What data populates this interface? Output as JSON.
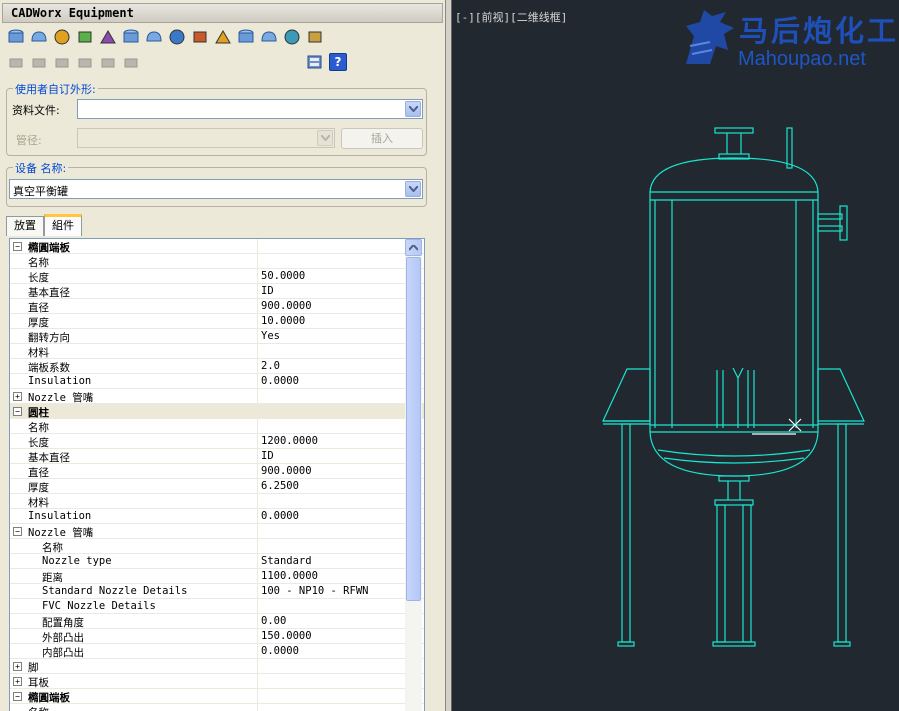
{
  "window": {
    "title": "CADWorx Equipment"
  },
  "toolbar": {
    "row1_icons": [
      "head-icon",
      "dish-icon",
      "flange-icon",
      "cone-icon",
      "elbow-icon",
      "sphere-icon",
      "box-icon",
      "nozzle-icon",
      "cube-icon",
      "coil-icon",
      "support-icon",
      "saddle-icon",
      "boot-icon",
      "tray-icon"
    ],
    "row2_icons": [
      "pipe-stub-icon",
      "bar-icon",
      "square-icon",
      "hexagon-icon",
      "octagon-icon",
      "shield-icon"
    ],
    "properties_icon": "properties-icon",
    "help_icon": "help-icon",
    "help_glyph": "?"
  },
  "custom_shape": {
    "legend": "使用者自订外形:",
    "datafile_label": "资料文件:",
    "datafile_value": "",
    "pipe_label": "管径:",
    "pipe_value": "",
    "insert_label": "插入"
  },
  "equipment": {
    "legend": "设备 名称:",
    "name_value": "真空平衡罐"
  },
  "tabs": [
    {
      "label": "放置",
      "active": false
    },
    {
      "label": "組件",
      "active": true
    }
  ],
  "grid": {
    "rows": [
      {
        "level": 0,
        "toggle": "−",
        "name": "橢圓端板",
        "value": "",
        "bold": true
      },
      {
        "level": 1,
        "toggle": "",
        "name": "名称",
        "value": ""
      },
      {
        "level": 1,
        "toggle": "",
        "name": "长度",
        "value": "50.0000"
      },
      {
        "level": 1,
        "toggle": "",
        "name": "基本直径",
        "value": "ID"
      },
      {
        "level": 1,
        "toggle": "",
        "name": "直径",
        "value": "900.0000"
      },
      {
        "level": 1,
        "toggle": "",
        "name": "厚度",
        "value": "10.0000"
      },
      {
        "level": 1,
        "toggle": "",
        "name": "翻转方向",
        "value": "Yes"
      },
      {
        "level": 1,
        "toggle": "",
        "name": "材料",
        "value": ""
      },
      {
        "level": 1,
        "toggle": "",
        "name": "端板系数",
        "value": "2.0"
      },
      {
        "level": 1,
        "toggle": "",
        "name": "Insulation",
        "value": "0.0000"
      },
      {
        "level": 0,
        "toggle": "+",
        "name": "Nozzle  管嘴",
        "value": ""
      },
      {
        "level": 0,
        "toggle": "−",
        "name": "圆柱",
        "value": "",
        "bold": true,
        "selected": true
      },
      {
        "level": 1,
        "toggle": "",
        "name": "名称",
        "value": ""
      },
      {
        "level": 1,
        "toggle": "",
        "name": "长度",
        "value": "1200.0000"
      },
      {
        "level": 1,
        "toggle": "",
        "name": "基本直径",
        "value": "ID"
      },
      {
        "level": 1,
        "toggle": "",
        "name": "直径",
        "value": "900.0000"
      },
      {
        "level": 1,
        "toggle": "",
        "name": "厚度",
        "value": "6.2500"
      },
      {
        "level": 1,
        "toggle": "",
        "name": "材料",
        "value": ""
      },
      {
        "level": 1,
        "toggle": "",
        "name": "Insulation",
        "value": "0.0000"
      },
      {
        "level": 0,
        "toggle": "−",
        "name": "Nozzle  管嘴",
        "value": ""
      },
      {
        "level": 2,
        "toggle": "",
        "name": "名称",
        "value": ""
      },
      {
        "level": 2,
        "toggle": "",
        "name": "Nozzle type",
        "value": "Standard"
      },
      {
        "level": 2,
        "toggle": "",
        "name": "距离",
        "value": "1100.0000"
      },
      {
        "level": 2,
        "toggle": "",
        "name": "Standard Nozzle Details",
        "value": "100 - NP10 - RFWN"
      },
      {
        "level": 2,
        "toggle": "",
        "name": "FVC Nozzle Details",
        "value": ""
      },
      {
        "level": 2,
        "toggle": "",
        "name": "配置角度",
        "value": "0.00"
      },
      {
        "level": 2,
        "toggle": "",
        "name": "外部凸出",
        "value": "150.0000"
      },
      {
        "level": 2,
        "toggle": "",
        "name": "内部凸出",
        "value": "0.0000"
      },
      {
        "level": 0,
        "toggle": "+",
        "name": "脚",
        "value": ""
      },
      {
        "level": 0,
        "toggle": "+",
        "name": "耳板",
        "value": ""
      },
      {
        "level": 0,
        "toggle": "−",
        "name": "橢圓端板",
        "value": "",
        "bold": true
      },
      {
        "level": 1,
        "toggle": "",
        "name": "名称",
        "value": ""
      }
    ]
  },
  "viewport": {
    "label": "[-][前视][二维线框]",
    "watermark_cn": "马后炮化工",
    "watermark_url": "Mahoupao.net",
    "line_color": "#19e6cf"
  }
}
